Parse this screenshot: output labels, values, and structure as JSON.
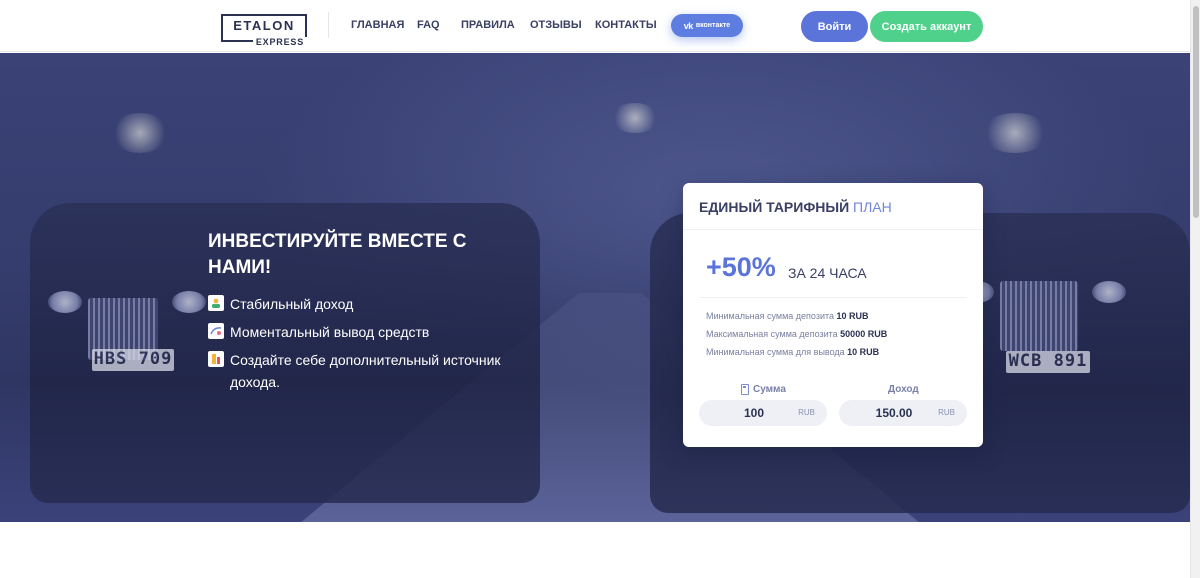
{
  "header": {
    "logo_top": "ETALON",
    "logo_bottom": "EXPRESS",
    "nav": [
      "ГЛАВНАЯ",
      "FAQ",
      "ПРАВИЛА",
      "ОТЗЫВЫ",
      "КОНТАКТЫ"
    ],
    "vk_logo": "vk",
    "vk_label": "вконтакте",
    "login_label": "Войти",
    "register_label": "Создать аккаунт"
  },
  "hero": {
    "title": "ИНВЕСТИРУЙТЕ ВМЕСТЕ С НАМИ!",
    "plates": [
      "HBS 709",
      "WCB 891"
    ],
    "features": [
      {
        "icon": "stable-income-icon",
        "text": "Стабильный доход"
      },
      {
        "icon": "instant-withdraw-icon",
        "text": "Моментальный вывод средств"
      },
      {
        "icon": "extra-income-icon",
        "text": "Создайте себе дополнительный источник дохода."
      }
    ]
  },
  "plan": {
    "title_main": "ЕДИНЫЙ ТАРИФНЫЙ",
    "title_accent": "ПЛАН",
    "percent": "+50%",
    "period": "ЗА 24 ЧАСА",
    "info": [
      {
        "label": "Минимальная сумма депозита",
        "value": "10 RUB"
      },
      {
        "label": "Максимальная сумма депозита",
        "value": "50000 RUB"
      },
      {
        "label": "Минимальная сумма для вывода",
        "value": "10 RUB"
      }
    ],
    "calc": {
      "amount_label": "Сумма",
      "income_label": "Доход",
      "amount_value": "100",
      "income_value": "150.00",
      "currency": "RUB"
    }
  },
  "colors": {
    "primary": "#5b74d9",
    "success": "#4fd18b",
    "hero_bg": "#353d6e",
    "text_dark": "#2b3151"
  }
}
